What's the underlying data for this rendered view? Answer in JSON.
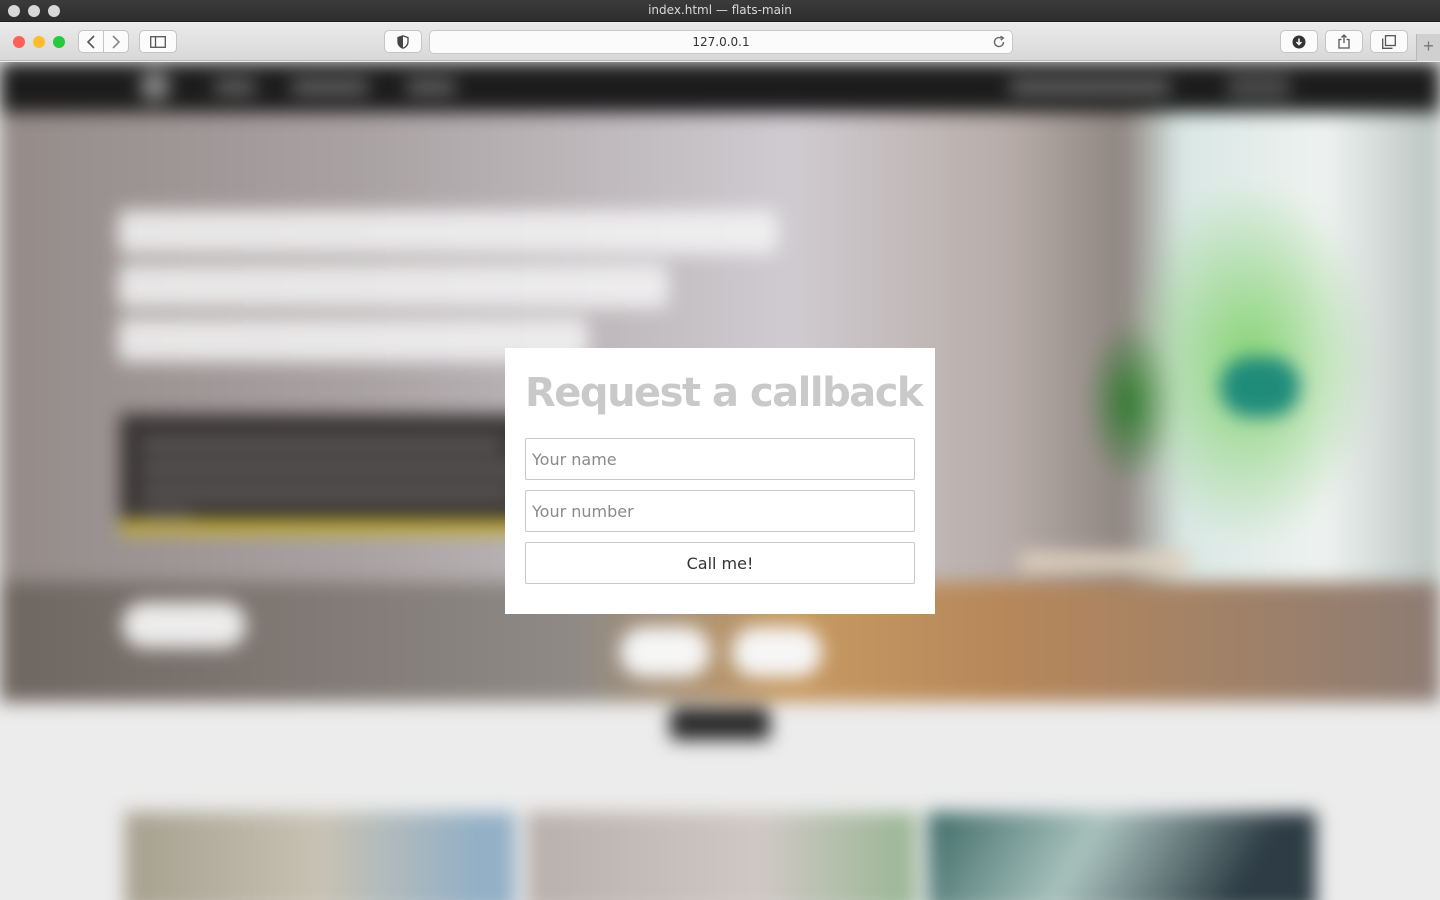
{
  "browser": {
    "window_title": "index.html — flats-main",
    "address": "127.0.0.1"
  },
  "icons": {
    "back": "chevron-left-icon",
    "forward": "chevron-right-icon",
    "sidebar": "sidebar-icon",
    "privacy": "shield-icon",
    "reload": "reload-icon",
    "download": "download-icon",
    "share": "share-icon",
    "tabs": "tabs-overview-icon",
    "new_tab": "plus-icon"
  },
  "colors": {
    "modal_title": "#c9c9c9",
    "accent_stripe": "#c9b232",
    "traffic_red": "#fe5f57",
    "traffic_yellow": "#febc2e",
    "traffic_green": "#28c840"
  },
  "modal": {
    "title": "Request a callback",
    "name_placeholder": "Your name",
    "number_placeholder": "Your number",
    "submit_label": "Call me!"
  }
}
